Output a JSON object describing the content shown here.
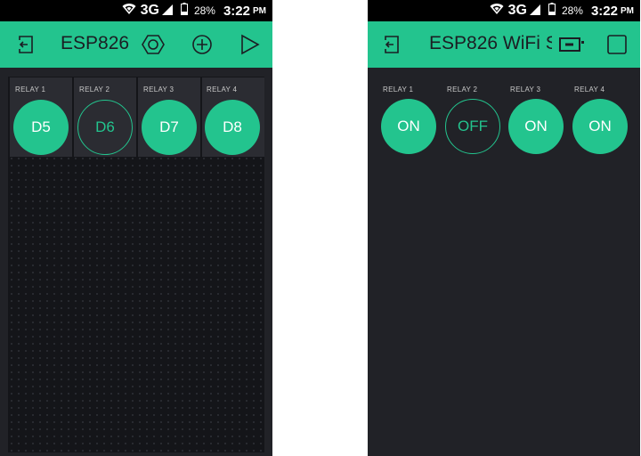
{
  "colors": {
    "accent": "#23c48e",
    "background": "#212227",
    "grid": "#141519",
    "tile": "#2b2c32"
  },
  "status_bar": {
    "network": "3G",
    "battery": "28%",
    "time": "3:22",
    "ampm": "PM"
  },
  "edit_screen": {
    "title": "ESP826",
    "icons": [
      "exit-icon",
      "settings-icon",
      "add-widget-icon",
      "play-icon"
    ],
    "widgets": [
      {
        "label": "RELAY 1",
        "pin": "D5",
        "state": "on"
      },
      {
        "label": "RELAY 2",
        "pin": "D6",
        "state": "off"
      },
      {
        "label": "RELAY 3",
        "pin": "D7",
        "state": "on"
      },
      {
        "label": "RELAY 4",
        "pin": "D8",
        "state": "on"
      }
    ]
  },
  "run_screen": {
    "title": "ESP826 WiFi S",
    "icons": [
      "exit-icon",
      "device-icon",
      "stop-icon"
    ],
    "widgets": [
      {
        "label": "RELAY 1",
        "value": "ON",
        "state": "on"
      },
      {
        "label": "RELAY 2",
        "value": "OFF",
        "state": "off"
      },
      {
        "label": "RELAY 3",
        "value": "ON",
        "state": "on"
      },
      {
        "label": "RELAY 4",
        "value": "ON",
        "state": "on"
      }
    ]
  }
}
